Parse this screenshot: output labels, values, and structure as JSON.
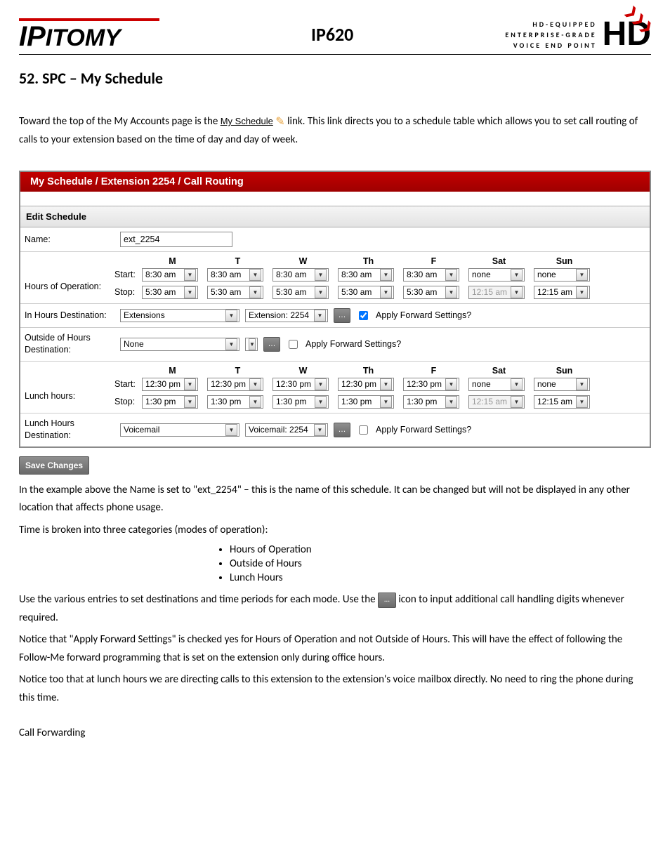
{
  "header": {
    "brand": "IPITOMY",
    "model": "IP620",
    "tag1": "HD-EQUIPPED",
    "tag2": "ENTERPRISE-GRADE",
    "tag3": "VOICE END POINT",
    "hd": "HD"
  },
  "section_title": "52. SPC – My Schedule",
  "intro": {
    "p1a": "Toward the top of the My Accounts page is the ",
    "link": "My Schedule",
    "p1b": " link. This link directs you to a schedule table which allows you to set call routing of calls to your extension based on the time of day and day of week."
  },
  "panel": {
    "title": "My Schedule / Extension 2254 / Call Routing",
    "edit": "Edit Schedule",
    "name_label": "Name:",
    "name_value": "ext_2254",
    "days": [
      "M",
      "T",
      "W",
      "Th",
      "F",
      "Sat",
      "Sun"
    ],
    "hours_label": "Hours of Operation:",
    "start_label": "Start:",
    "stop_label": "Stop:",
    "hours_start": [
      "8:30 am",
      "8:30 am",
      "8:30 am",
      "8:30 am",
      "8:30 am",
      "none",
      "none"
    ],
    "hours_stop": [
      "5:30 am",
      "5:30 am",
      "5:30 am",
      "5:30 am",
      "5:30 am",
      "12:15 am",
      "12:15 am"
    ],
    "in_hours_label": "In Hours Destination:",
    "in_hours_dest1": "Extensions",
    "in_hours_dest2": "Extension: 2254",
    "apply_fwd": "Apply Forward Settings?",
    "out_hours_label": "Outside of Hours Destination:",
    "out_hours_dest": "None",
    "lunch_label": "Lunch hours:",
    "lunch_start": [
      "12:30 pm",
      "12:30 pm",
      "12:30 pm",
      "12:30 pm",
      "12:30 pm",
      "none",
      "none"
    ],
    "lunch_stop": [
      "1:30 pm",
      "1:30 pm",
      "1:30 pm",
      "1:30 pm",
      "1:30 pm",
      "12:15 am",
      "12:15 am"
    ],
    "lunch_dest_label": "Lunch Hours Destination:",
    "lunch_dest1": "Voicemail",
    "lunch_dest2": "Voicemail: 2254",
    "save": "Save Changes"
  },
  "body": {
    "p2": "In the example above the Name is set to \"ext_2254\" – this is the name of this schedule. It can be changed but will not be displayed in any other location that affects phone usage.",
    "p3": "Time is broken into three categories (modes of operation):",
    "bullets": [
      "Hours of Operation",
      "Outside of Hours",
      "Lunch Hours"
    ],
    "p4a": "Use the various entries to set destinations and time periods for each mode. Use the ",
    "p4b": " icon to input additional call handling digits whenever required.",
    "p5": "Notice that \"Apply Forward Settings\" is checked yes for Hours of Operation and not Outside of Hours. This will have the effect of following the Follow-Me forward programming that is set on the extension only during office hours.",
    "p6": "Notice too that at lunch hours we are directing calls to this extension to the extension's voice mailbox directly. No need to ring the phone during this time.",
    "p7": "Call Forwarding"
  }
}
